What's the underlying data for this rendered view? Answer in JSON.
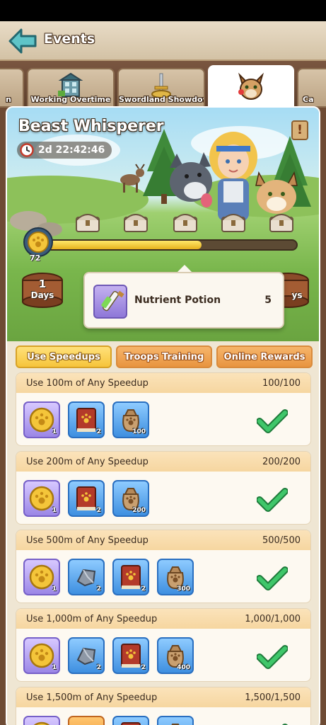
{
  "topbar": {
    "title": "Events"
  },
  "tabs": [
    {
      "label": "n",
      "icon": "partial-tab-icon"
    },
    {
      "label": "Working Overtime",
      "icon": "building-icon"
    },
    {
      "label": "Swordland Showdown",
      "icon": "sword-trophy-icon"
    },
    {
      "label": "",
      "icon": "beast-cat-icon",
      "active": true
    },
    {
      "label": "Ca",
      "icon": "partial-tab-icon"
    }
  ],
  "banner": {
    "title": "Beast Whisperer",
    "timer": "2d 22:42:46",
    "info": "!",
    "points": "72",
    "progress": 0.62
  },
  "days": [
    {
      "num": "1",
      "label": "Days"
    },
    {
      "num": "",
      "label": "ys"
    }
  ],
  "tooltip": {
    "name": "Nutrient Potion",
    "qty": "5"
  },
  "subtabs": [
    {
      "label": "Use Speedups",
      "active": true
    },
    {
      "label": "Troops Training",
      "active": false
    },
    {
      "label": "Online Rewards",
      "active": false
    }
  ],
  "tasks": [
    {
      "title": "Use 100m of Any Speedup",
      "progress": "100/100",
      "rewards": [
        {
          "type": "coin",
          "qty": "1"
        },
        {
          "type": "book",
          "qty": "2"
        },
        {
          "type": "sack",
          "qty": "100"
        }
      ]
    },
    {
      "title": "Use 200m of Any Speedup",
      "progress": "200/200",
      "rewards": [
        {
          "type": "coin",
          "qty": "1"
        },
        {
          "type": "book",
          "qty": "2"
        },
        {
          "type": "sack",
          "qty": "200"
        }
      ]
    },
    {
      "title": "Use 500m of Any Speedup",
      "progress": "500/500",
      "rewards": [
        {
          "type": "coin",
          "qty": "1"
        },
        {
          "type": "stone",
          "qty": "2"
        },
        {
          "type": "book",
          "qty": "2"
        },
        {
          "type": "sack",
          "qty": "300"
        }
      ]
    },
    {
      "title": "Use 1,000m of Any Speedup",
      "progress": "1,000/1,000",
      "rewards": [
        {
          "type": "coin",
          "qty": "1"
        },
        {
          "type": "stone",
          "qty": "2"
        },
        {
          "type": "book",
          "qty": "2"
        },
        {
          "type": "sack",
          "qty": "400"
        }
      ]
    },
    {
      "title": "Use 1,500m of Any Speedup",
      "progress": "1,500/1,500",
      "rewards": [
        {
          "type": "coin",
          "qty": ""
        },
        {
          "type": "stone-orange",
          "qty": ""
        },
        {
          "type": "book",
          "qty": ""
        },
        {
          "type": "sack",
          "qty": ""
        }
      ]
    }
  ]
}
